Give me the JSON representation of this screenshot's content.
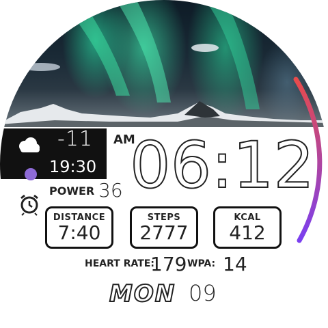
{
  "weather": {
    "icon": "cloud-icon",
    "temperature": "-11",
    "time": "19:30"
  },
  "clock": {
    "ampm": "AM",
    "time": "06:12"
  },
  "power": {
    "label": "POWER",
    "value": "36"
  },
  "stats": {
    "distance": {
      "label": "DISTANCE",
      "value": "7:40"
    },
    "steps": {
      "label": "STEPS",
      "value": "2777"
    },
    "kcal": {
      "label": "KCAL",
      "value": "412"
    }
  },
  "vitals": {
    "heart_rate_label": "HEART RATE:",
    "heart_rate_value": "179",
    "wpa_label": "WPA:",
    "wpa_value": "14"
  },
  "date": {
    "day": "MON",
    "date": "09"
  },
  "colors": {
    "arc_top": "#e84b4b",
    "arc_bottom": "#7a3ff0",
    "moon": "#8e6bd6"
  }
}
